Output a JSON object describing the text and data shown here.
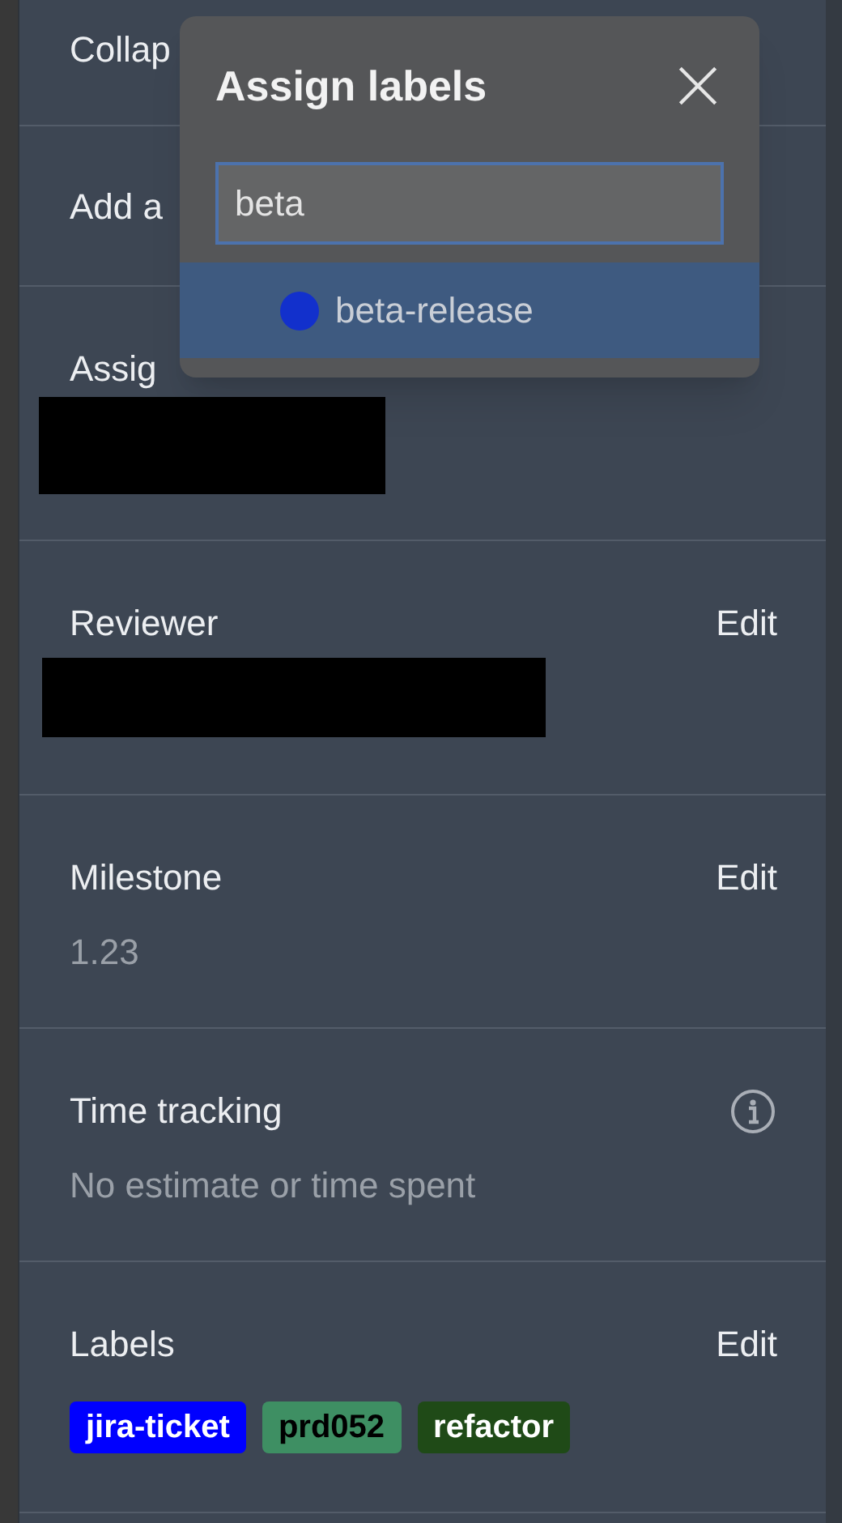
{
  "sidebar": {
    "sections": [
      {
        "kind": "collapse",
        "label": "Collap"
      },
      {
        "kind": "add",
        "label": "Add a"
      },
      {
        "kind": "person",
        "label": "Assig",
        "redacted": true
      },
      {
        "kind": "person",
        "label": "Reviewer",
        "action": "Edit",
        "redacted": true
      },
      {
        "kind": "value",
        "label": "Milestone",
        "action": "Edit",
        "value": "1.23"
      },
      {
        "kind": "info",
        "label": "Time tracking",
        "value": "No estimate or time spent"
      },
      {
        "kind": "labels",
        "label": "Labels",
        "action": "Edit",
        "labels": [
          {
            "text": "jira-ticket",
            "color": "#0000ff"
          },
          {
            "text": "prd052",
            "color": "#3e8f63"
          },
          {
            "text": "refactor",
            "color": "#1f4a17"
          }
        ]
      }
    ]
  },
  "popup": {
    "title": "Assign labels",
    "search": {
      "value": "beta"
    },
    "options": [
      {
        "text": "beta-release",
        "color": "#1230cc",
        "selected": true
      }
    ]
  }
}
